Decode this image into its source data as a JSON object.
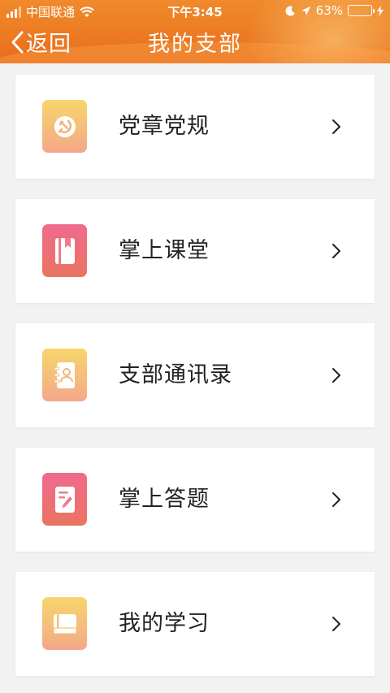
{
  "status_bar": {
    "carrier": "中国联通",
    "time": "下午3:45",
    "battery_percent": "63%",
    "battery_color": "#ffd23a"
  },
  "nav": {
    "back_label": "返回",
    "title": "我的支部",
    "header_color": "#ec7a22"
  },
  "menu": [
    {
      "label": "党章党规",
      "icon": "party-emblem-icon",
      "icon_style": "gold"
    },
    {
      "label": "掌上课堂",
      "icon": "bookmark-book-icon",
      "icon_style": "pink"
    },
    {
      "label": "支部通讯录",
      "icon": "contact-book-icon",
      "icon_style": "gold"
    },
    {
      "label": "掌上答题",
      "icon": "edit-note-icon",
      "icon_style": "pink"
    },
    {
      "label": "我的学习",
      "icon": "book-icon",
      "icon_style": "gold"
    }
  ]
}
